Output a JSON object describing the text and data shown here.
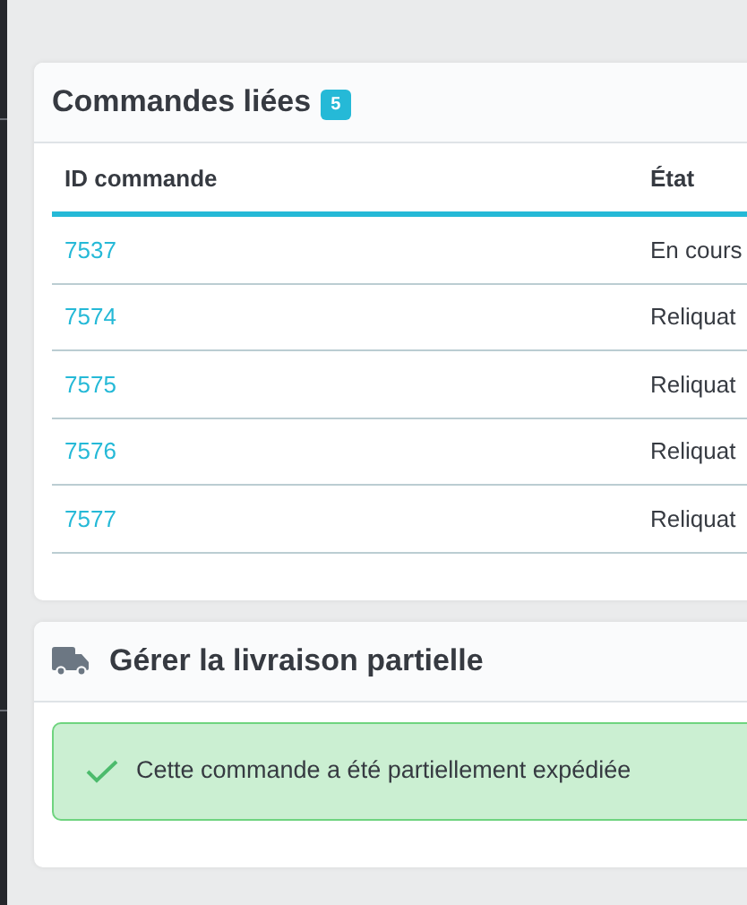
{
  "linked_orders": {
    "title": "Commandes liées",
    "count": "5",
    "columns": [
      "ID commande",
      "État"
    ],
    "rows": [
      {
        "id": "7537",
        "state": "En cours"
      },
      {
        "id": "7574",
        "state": "Reliquat"
      },
      {
        "id": "7575",
        "state": "Reliquat"
      },
      {
        "id": "7576",
        "state": "Reliquat"
      },
      {
        "id": "7577",
        "state": "Reliquat"
      }
    ]
  },
  "partial_delivery": {
    "title": "Gérer la livraison partielle",
    "alert": {
      "kind": "success",
      "text": "Cette commande a été partiellement expédiée"
    }
  }
}
